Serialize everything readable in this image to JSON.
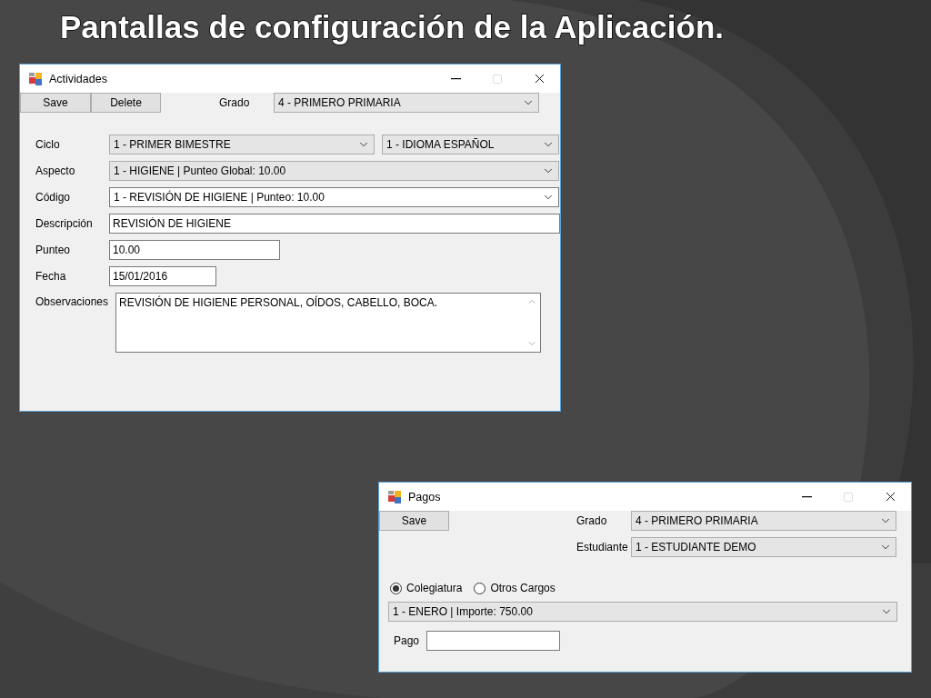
{
  "slide_title": "Pantallas de configuración de la Aplicación.",
  "actividades": {
    "title": "Actividades",
    "buttons": [
      "Save",
      "Delete"
    ],
    "grado": {
      "label": "Grado",
      "value": "4 - PRIMERO PRIMARIA"
    },
    "rows": [
      {
        "kind": "combo",
        "label": "Ciclo",
        "values": [
          "1 - PRIMER BIMESTRE",
          "1 - IDIOMA ESPAÑOL"
        ]
      },
      {
        "kind": "combo",
        "label": "Aspecto",
        "values": [
          "1 - HIGIENE | Punteo Global: 10.00"
        ]
      },
      {
        "kind": "editcombo",
        "label": "Código",
        "values": [
          "1 - REVISIÓN DE HIGIENE | Punteo: 10.00"
        ]
      },
      {
        "kind": "text",
        "label": "Descripción",
        "value": "REVISIÓN DE HIGIENE"
      },
      {
        "kind": "number",
        "label": "Punteo",
        "value": "10.00"
      },
      {
        "kind": "date",
        "label": "Fecha",
        "value": "15/01/2016"
      },
      {
        "kind": "memo",
        "label": "Observaciones",
        "value": "REVISIÓN DE HIGIENE PERSONAL, OÍDOS, CABELLO, BOCA."
      }
    ]
  },
  "pagos": {
    "title": "Pagos",
    "buttons": [
      "Save"
    ],
    "combos": [
      {
        "label": "Grado",
        "value": "4 - PRIMERO PRIMARIA"
      },
      {
        "label": "Estudiante",
        "value": "1 - ESTUDIANTE DEMO"
      }
    ],
    "radios": [
      {
        "label": "Colegiatura",
        "selected": true
      },
      {
        "label": "Otros Cargos",
        "selected": false
      }
    ],
    "concepto": "1 - ENERO | Importe: 750.00",
    "pago": {
      "label": "Pago"
    }
  }
}
